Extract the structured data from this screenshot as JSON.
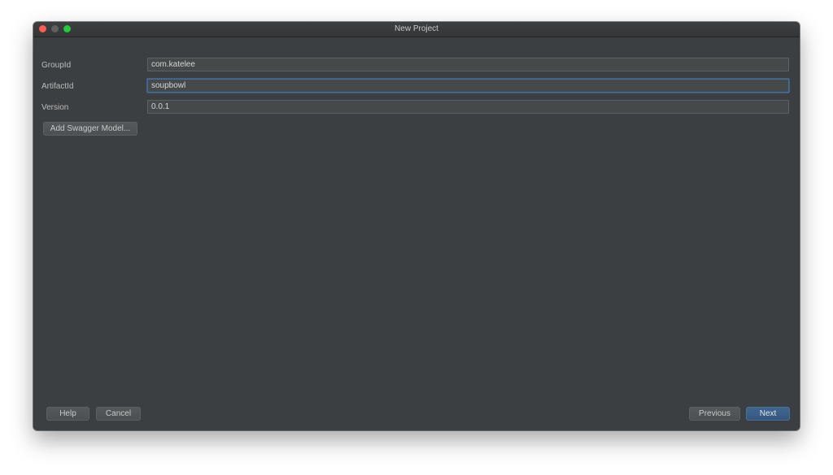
{
  "window": {
    "title": "New Project"
  },
  "form": {
    "group_id": {
      "label": "GroupId",
      "value": "com.katelee"
    },
    "artifact_id": {
      "label": "ArtifactId",
      "value": "soupbowl"
    },
    "version": {
      "label": "Version",
      "value": "0.0.1"
    },
    "add_swagger_label": "Add Swagger Model..."
  },
  "footer": {
    "help_label": "Help",
    "cancel_label": "Cancel",
    "previous_label": "Previous",
    "next_label": "Next"
  },
  "colors": {
    "background": "#3c3f41",
    "field_background": "#45494a",
    "accent": "#365880",
    "focus_border": "#466d94",
    "close_button": "#fe5f57",
    "maximize_button": "#28c840"
  }
}
